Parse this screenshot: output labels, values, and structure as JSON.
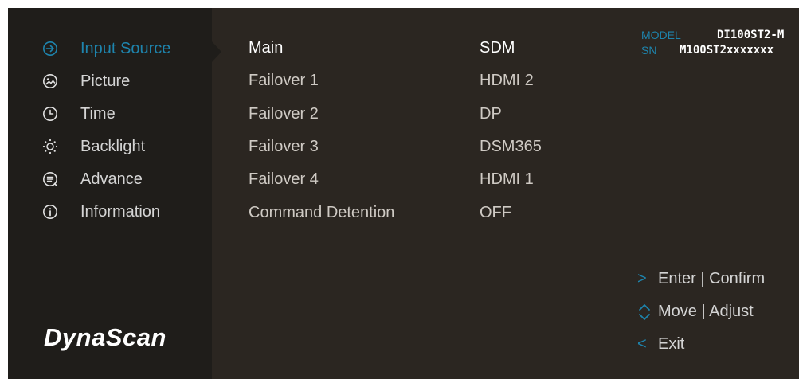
{
  "menu": [
    {
      "label": "Input Source",
      "icon": "arrow-circle-right-icon",
      "active": true
    },
    {
      "label": "Picture",
      "icon": "picture-icon",
      "active": false
    },
    {
      "label": "Time",
      "icon": "clock-icon",
      "active": false
    },
    {
      "label": "Backlight",
      "icon": "sun-icon",
      "active": false
    },
    {
      "label": "Advance",
      "icon": "advance-icon",
      "active": false
    },
    {
      "label": "Information",
      "icon": "info-icon",
      "active": false
    }
  ],
  "logo": "DynaScan",
  "settings": [
    {
      "label": "Main",
      "value": "SDM"
    },
    {
      "label": "Failover 1",
      "value": "HDMI 2"
    },
    {
      "label": "Failover 2",
      "value": "DP"
    },
    {
      "label": "Failover 3",
      "value": "DSM365"
    },
    {
      "label": "Failover 4",
      "value": "HDMI 1"
    },
    {
      "label": "Command Detention",
      "value": "OFF"
    }
  ],
  "device": {
    "model_label": "MODEL",
    "model_value": "DI100ST2-M",
    "sn_label": "SN",
    "sn_value": "M100ST2xxxxxxx"
  },
  "hints": [
    {
      "icon": "chevron-right-icon",
      "glyph": ">",
      "text": "Enter | Confirm"
    },
    {
      "icon": "up-down-icon",
      "glyph": "",
      "text": "Move | Adjust"
    },
    {
      "icon": "chevron-left-icon",
      "glyph": "<",
      "text": "Exit"
    }
  ],
  "colors": {
    "accent": "#1e84ad",
    "panel": "#2b2621",
    "sidebar": "#1f1d1a"
  }
}
